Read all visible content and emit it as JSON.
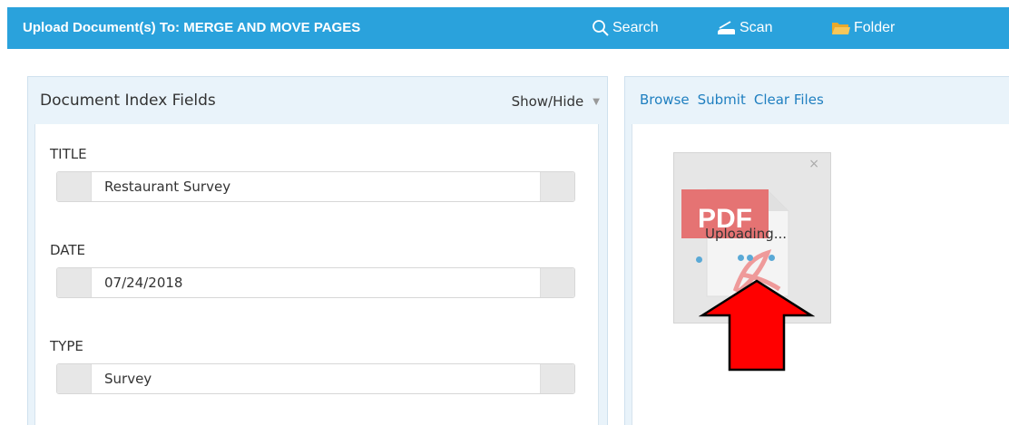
{
  "header": {
    "title": "Upload Document(s) To:  MERGE AND MOVE PAGES",
    "actions": {
      "search": "Search",
      "scan": "Scan",
      "folder": "Folder"
    }
  },
  "left_panel": {
    "title": "Document Index Fields",
    "show_hide": "Show/Hide",
    "fields": [
      {
        "label": "TITLE",
        "value": "Restaurant Survey"
      },
      {
        "label": "DATE",
        "value": "07/24/2018"
      },
      {
        "label": "TYPE",
        "value": "Survey"
      }
    ]
  },
  "right_panel": {
    "links": {
      "browse": "Browse",
      "submit": "Submit",
      "clear": "Clear Files"
    },
    "file": {
      "icon_label": "PDF",
      "status": "Uploading...",
      "close": "×"
    }
  },
  "colors": {
    "header_bg": "#2aa2dc",
    "link": "#1f7fc0",
    "arrow": "#ff0000"
  }
}
